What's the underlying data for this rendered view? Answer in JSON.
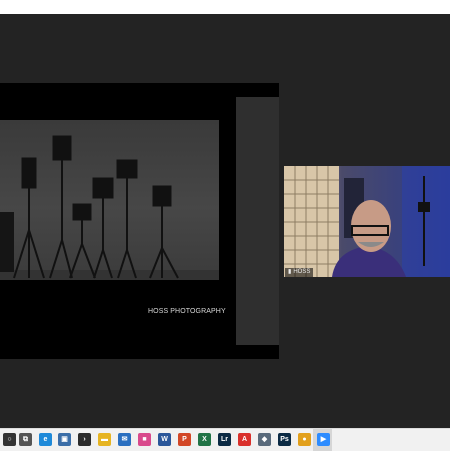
{
  "shared_screen": {
    "caption": "HOSS PHOTOGRAPHY"
  },
  "participant": {
    "name": "HOSS"
  },
  "taskbar": {
    "icons": [
      {
        "name": "start-icon",
        "color": "#333333",
        "glyph": "○"
      },
      {
        "name": "task-view-icon",
        "color": "#555555",
        "glyph": "⧉"
      },
      {
        "name": "edge-icon",
        "color": "#1f8ad9",
        "glyph": "e"
      },
      {
        "name": "store-icon",
        "color": "#3b6ea8",
        "glyph": "▣"
      },
      {
        "name": "media-icon",
        "color": "#2b2b2b",
        "glyph": "›"
      },
      {
        "name": "file-explorer-icon",
        "color": "#e6b422",
        "glyph": "▬"
      },
      {
        "name": "mail-icon",
        "color": "#2a6fc0",
        "glyph": "✉"
      },
      {
        "name": "photos-icon",
        "color": "#d94a8c",
        "glyph": "■"
      },
      {
        "name": "word-icon",
        "color": "#2b579a",
        "glyph": "W"
      },
      {
        "name": "powerpoint-icon",
        "color": "#d24726",
        "glyph": "P"
      },
      {
        "name": "excel-icon",
        "color": "#217346",
        "glyph": "X"
      },
      {
        "name": "lightroom-icon",
        "color": "#0b2a44",
        "glyph": "Lr"
      },
      {
        "name": "acrobat-icon",
        "color": "#d9302b",
        "glyph": "A"
      },
      {
        "name": "shield-icon",
        "color": "#5a6b7c",
        "glyph": "◆"
      },
      {
        "name": "photoshop-icon",
        "color": "#0b2a44",
        "glyph": "Ps"
      },
      {
        "name": "chrome-icon",
        "color": "#e2a01c",
        "glyph": "●"
      },
      {
        "name": "zoom-icon",
        "color": "#2d8cff",
        "glyph": "▶"
      }
    ]
  }
}
